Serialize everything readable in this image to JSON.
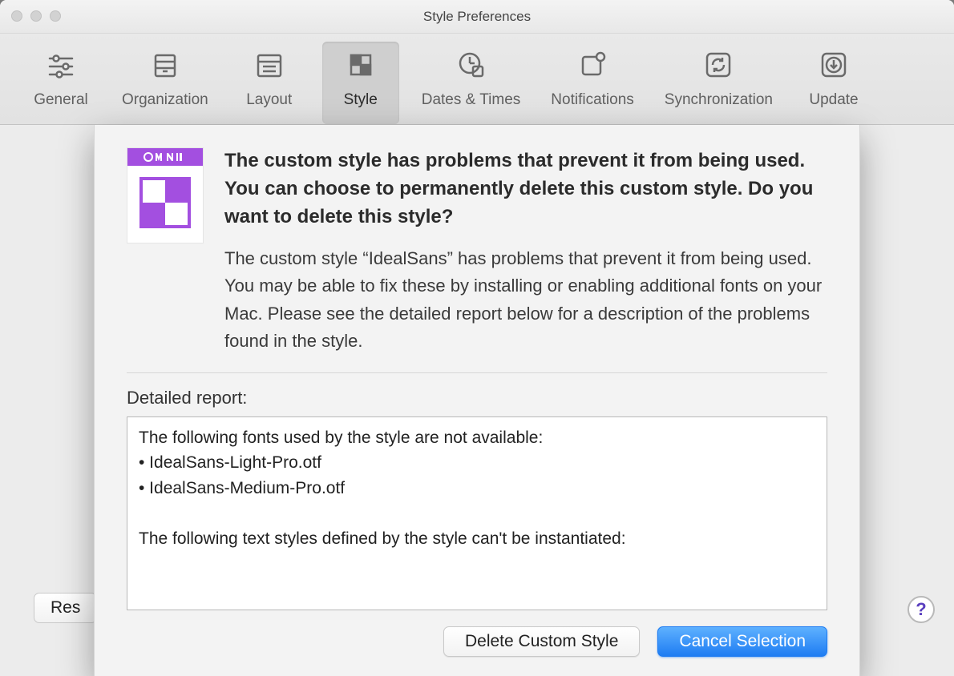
{
  "window": {
    "title": "Style Preferences"
  },
  "toolbar": {
    "items": [
      {
        "label": "General"
      },
      {
        "label": "Organization"
      },
      {
        "label": "Layout"
      },
      {
        "label": "Style"
      },
      {
        "label": "Dates & Times"
      },
      {
        "label": "Notifications"
      },
      {
        "label": "Synchronization"
      },
      {
        "label": "Update"
      }
    ],
    "selected_index": 3
  },
  "sheet": {
    "icon_brand": "OMNI",
    "heading": "The custom style has problems that prevent it from being used. You can choose to permanently delete this custom style. Do you want to delete this style?",
    "body": "The custom style “IdealSans” has problems that prevent it from being used. You may be able to fix these by installing or enabling additional fonts on your Mac. Please see the detailed report below for a description of the problems found in the style.",
    "report_label": "Detailed report:",
    "report_text": "The following fonts used by the style are not available:\n• IdealSans-Light-Pro.otf\n• IdealSans-Medium-Pro.otf\n\nThe following text styles defined by the style can't be instantiated:",
    "delete_label": "Delete Custom Style",
    "cancel_label": "Cancel Selection"
  },
  "footer": {
    "reset_label_partial": "Res",
    "help_glyph": "?"
  }
}
